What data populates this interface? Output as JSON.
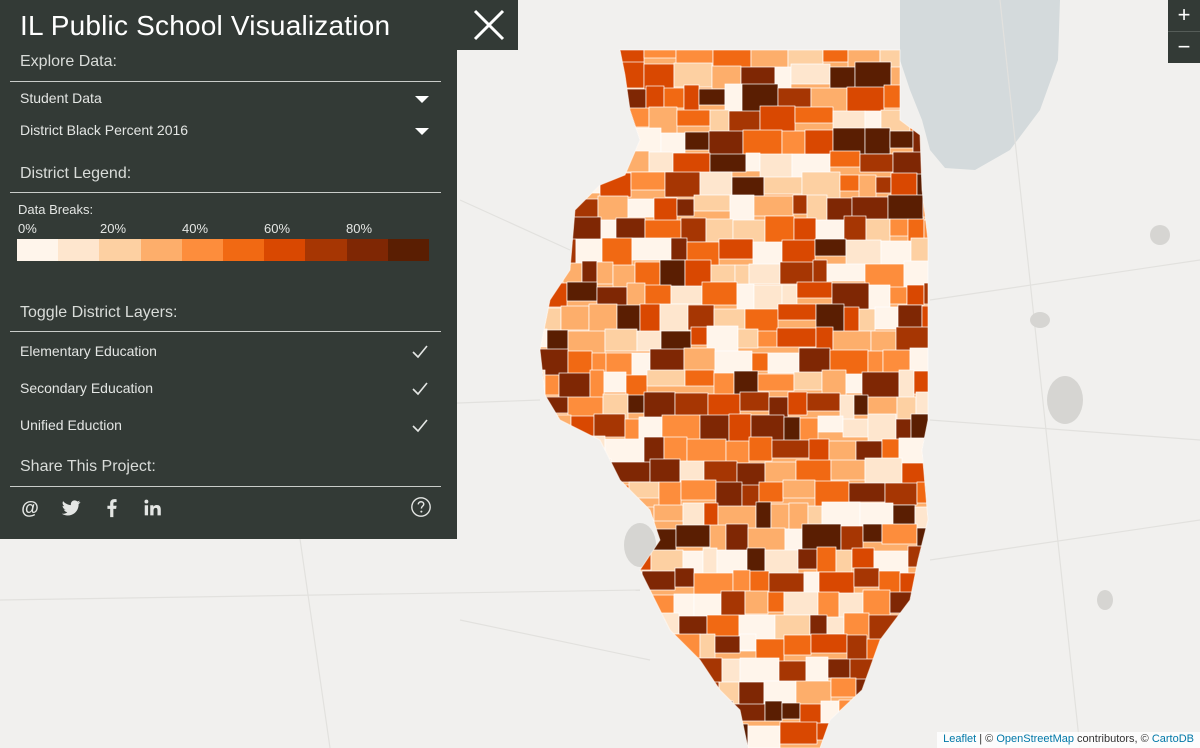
{
  "app": {
    "title": "IL Public School Visualization"
  },
  "panel": {
    "explore_heading": "Explore Data:",
    "dropdowns": [
      {
        "label": "Student Data"
      },
      {
        "label": "District Black Percent 2016"
      }
    ],
    "legend_heading": "District Legend:",
    "breaks_title": "Data Breaks:",
    "break_labels": [
      "0%",
      "20%",
      "40%",
      "60%",
      "80%"
    ],
    "ramp_colors": [
      "#fff5eb",
      "#fee6ce",
      "#fdd0a2",
      "#fdae6b",
      "#fd8d3c",
      "#f16913",
      "#d94801",
      "#a63603",
      "#7f2704",
      "#5a1e02"
    ],
    "toggle_heading": "Toggle District Layers:",
    "toggles": [
      {
        "label": "Elementary Education",
        "checked": true
      },
      {
        "label": "Secondary Education",
        "checked": true
      },
      {
        "label": "Unified Eduction",
        "checked": true
      }
    ],
    "share_heading": "Share This Project:",
    "share_icons": [
      "email-icon",
      "twitter-icon",
      "facebook-icon",
      "linkedin-icon"
    ],
    "help_icon": "help-icon"
  },
  "zoom": {
    "in": "+",
    "out": "−"
  },
  "attribution": {
    "leaflet": "Leaflet",
    "sep1": " | © ",
    "osm": "OpenStreetMap",
    "contrib": " contributors, © ",
    "carto": "CartoDB"
  },
  "map": {
    "basemap_color": "#f1f0ee",
    "water_color": "#d4dadc",
    "region": "Illinois",
    "choropleth_colors": [
      "#fff5eb",
      "#fee6ce",
      "#fdd0a2",
      "#fdae6b",
      "#fd8d3c",
      "#f16913",
      "#d94801",
      "#a63603",
      "#7f2704",
      "#5a1e02"
    ]
  }
}
